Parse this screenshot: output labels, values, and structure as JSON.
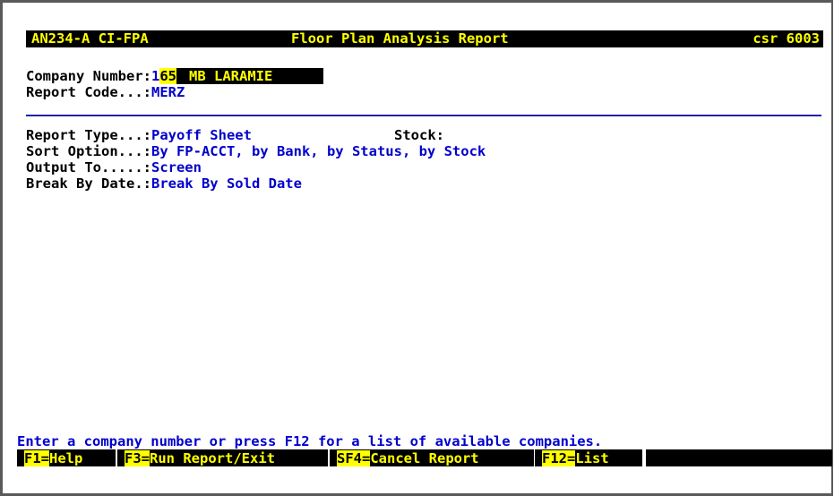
{
  "header": {
    "program_id": "AN234-A CI-FPA",
    "title": "Floor Plan Analysis Report",
    "user": "csr 6003"
  },
  "fields": {
    "company_number_label": "Company Number:",
    "company_number_value_pre": "1",
    "company_number_value_hl": "65",
    "company_name": "MB LARAMIE",
    "report_code_label": "Report Code...:",
    "report_code_value": "MERZ",
    "report_type_label": "Report Type...:",
    "report_type_value": "Payoff Sheet",
    "stock_label": "Stock:",
    "sort_option_label": "Sort Option...:",
    "sort_option_value": "By FP-ACCT, by Bank, by Status, by Stock",
    "output_to_label": "Output To.....:",
    "output_to_value": "Screen",
    "break_by_label": "Break By Date.:",
    "break_by_value": "Break By Sold Date"
  },
  "prompt": "Enter a company number or press F12 for a list of available companies.",
  "function_keys": [
    {
      "key": "F1=",
      "label": "Help"
    },
    {
      "key": "F3=",
      "label": "Run Report/Exit"
    },
    {
      "key": "SF4=",
      "label": "Cancel Report"
    },
    {
      "key": "F12=",
      "label": "List"
    }
  ],
  "colors": {
    "background": "#ffffff",
    "label": "#000000",
    "value": "#0000cc",
    "highlight": "#ffff00",
    "inverse_bg": "#000000"
  }
}
